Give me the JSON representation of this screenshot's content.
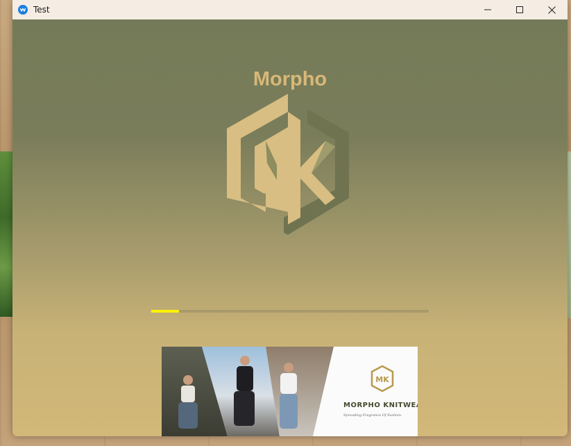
{
  "window": {
    "title": "Test",
    "icon": "app-logo-icon",
    "controls": [
      "minimize-icon",
      "maximize-icon",
      "close-icon"
    ]
  },
  "splash": {
    "brand_name": "Morpho",
    "logo_letters": "MK",
    "progress": 0.1,
    "accent_colors": {
      "brand_text": "#d8b878",
      "progress_fill": "#fff200",
      "progress_track": "#a9996a"
    }
  },
  "banner": {
    "brand": "MORPHO KNITWEAR",
    "tagline": "Spreading Fragrance Of Fashion."
  }
}
